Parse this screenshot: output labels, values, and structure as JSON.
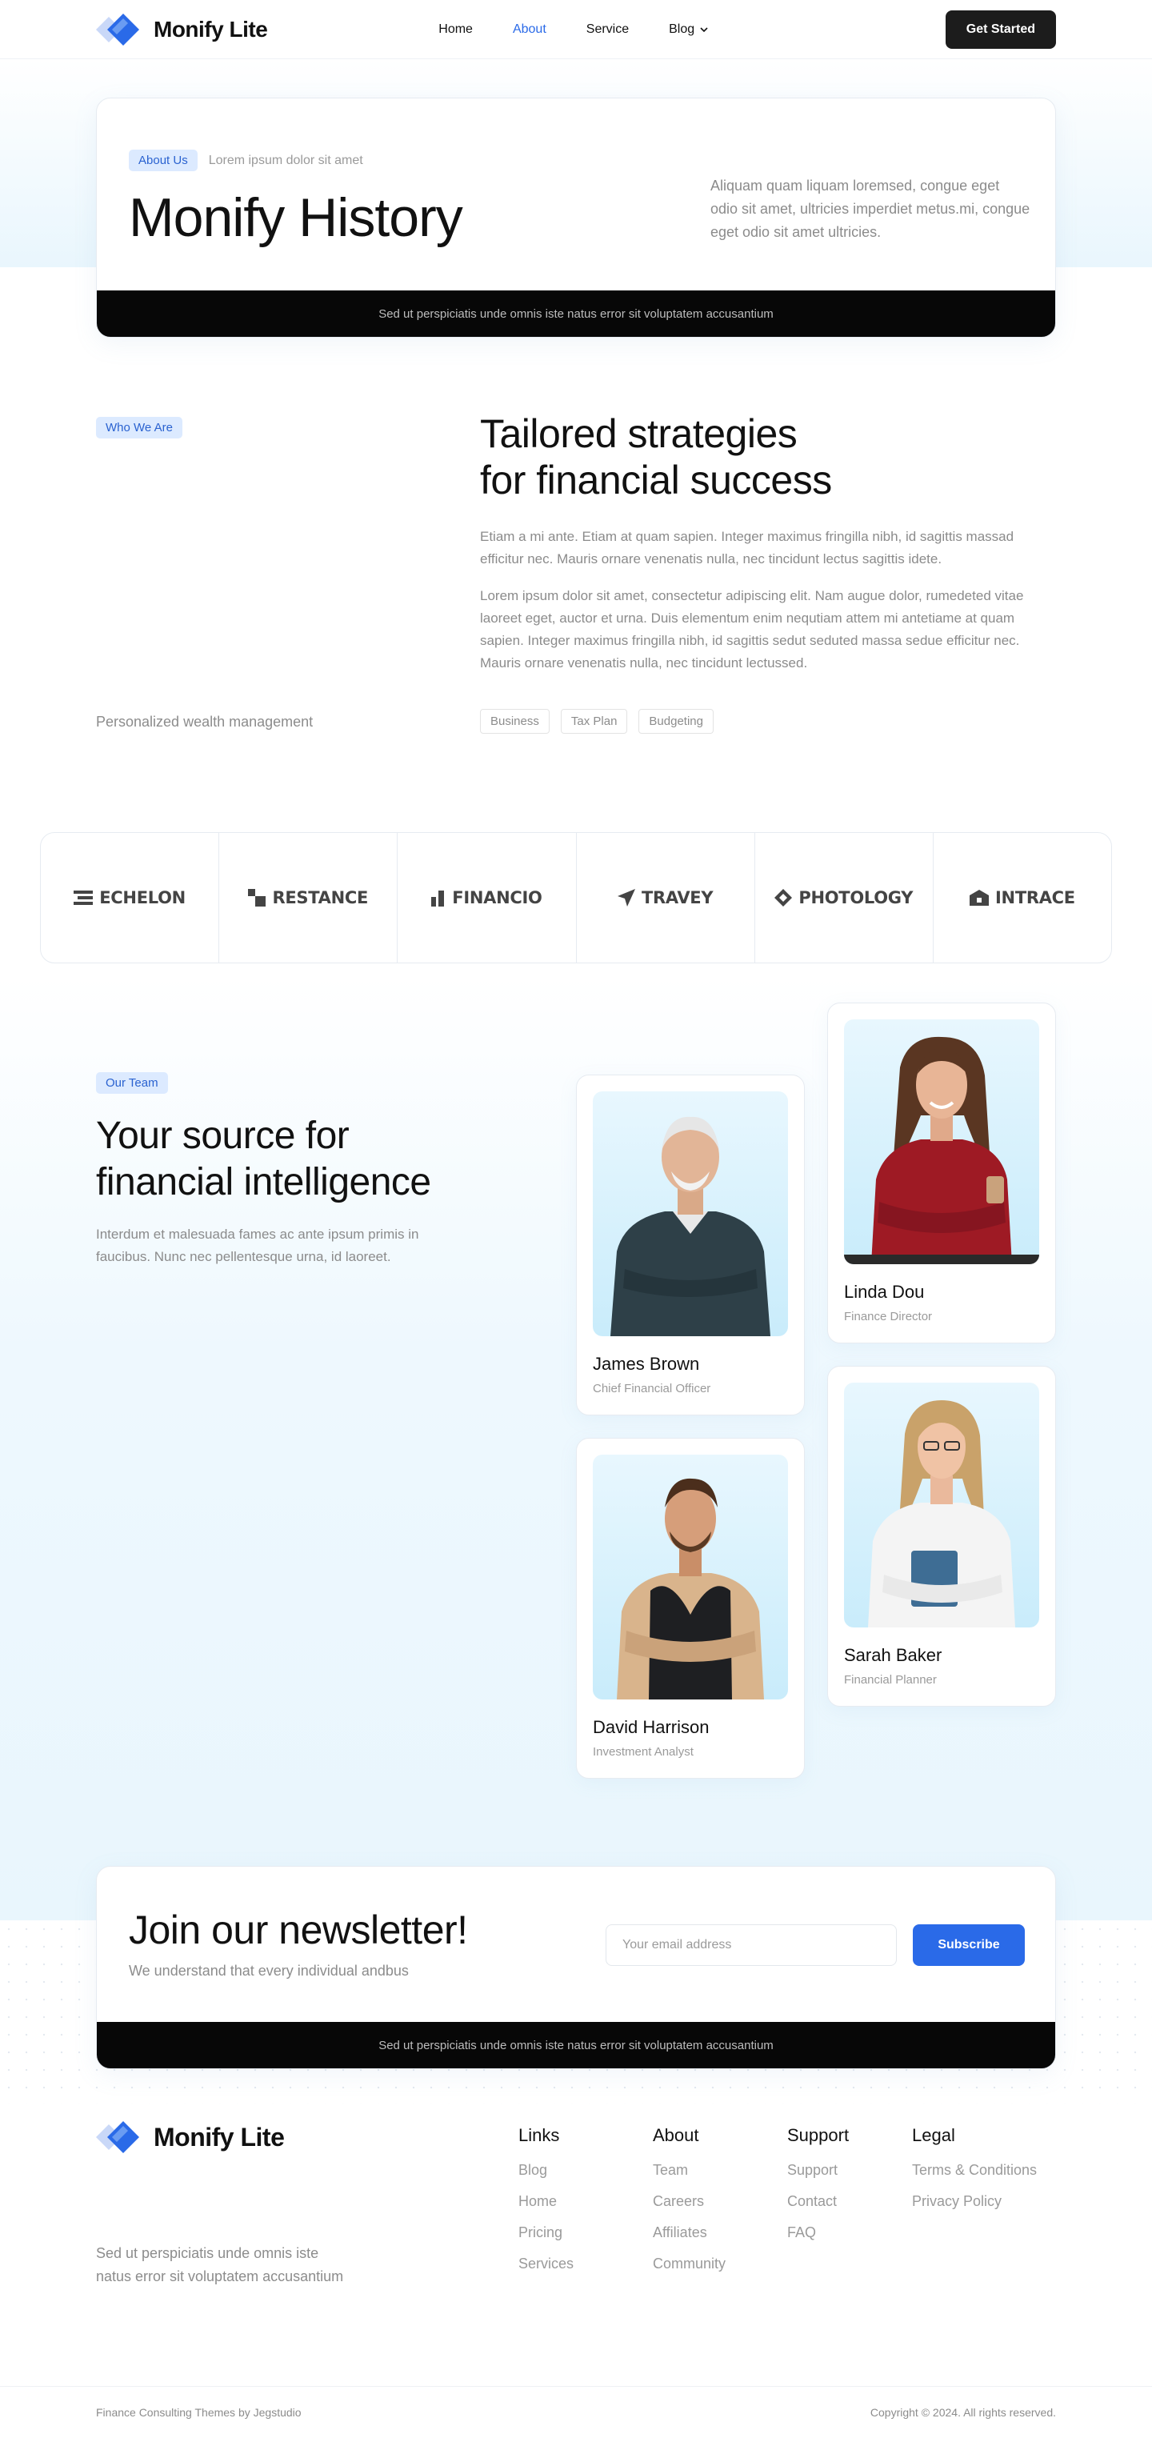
{
  "header": {
    "brand": "Monify Lite",
    "nav": [
      {
        "label": "Home",
        "active": false
      },
      {
        "label": "About",
        "active": true
      },
      {
        "label": "Service",
        "active": false
      },
      {
        "label": "Blog",
        "active": false
      }
    ],
    "cta_label": "Get Started"
  },
  "hero": {
    "badge": "About Us",
    "badge_sub": "Lorem ipsum dolor sit amet",
    "title": "Monify History",
    "description": "Aliquam quam liquam loremsed, congue eget odio sit amet, ultricies imperdiet metus.mi, congue eget odio sit amet ultricies.",
    "strip_text": "Sed ut perspiciatis unde omnis iste natus error sit voluptatem accusantium"
  },
  "who": {
    "badge": "Who We Are",
    "caption": "Personalized wealth management",
    "title_line1": "Tailored strategies",
    "title_line2": "for financial success",
    "p1": "Etiam a mi ante. Etiam at quam sapien. Integer maximus fringilla nibh, id sagittis massad efficitur nec. Mauris ornare venenatis nulla, nec tincidunt lectus sagittis idete.",
    "p2": "Lorem ipsum dolor sit amet, consectetur adipiscing elit. Nam augue dolor, rumedeted vitae laoreet eget, auctor et urna. Duis elementum enim nequtiam attem mi antetiame at quam sapien. Integer maximus fringilla nibh, id sagittis sedut seduted massa sedue efficitur nec. Mauris ornare venenatis nulla, nec tincidunt lectussed.",
    "tags": [
      "Business",
      "Tax Plan",
      "Budgeting"
    ]
  },
  "partners": [
    {
      "name": "ECHELON",
      "icon": "echelon-icon"
    },
    {
      "name": "RESTANCE",
      "icon": "restance-icon"
    },
    {
      "name": "FINANCIO",
      "icon": "financio-icon"
    },
    {
      "name": "TRAVEY",
      "icon": "travey-icon"
    },
    {
      "name": "PHOTOLOGY",
      "icon": "photology-icon"
    },
    {
      "name": "INTRACE",
      "icon": "intrace-icon"
    }
  ],
  "team": {
    "badge": "Our Team",
    "title_line1": "Your source for",
    "title_line2": "financial intelligence",
    "description": "Interdum et malesuada fames ac ante ipsum primis in faucibus. Nunc nec pellentesque urna, id laoreet.",
    "members": [
      {
        "name": "James Brown",
        "role": "Chief Financial Officer"
      },
      {
        "name": "Linda Dou",
        "role": "Finance Director"
      },
      {
        "name": "David Harrison",
        "role": "Investment Analyst"
      },
      {
        "name": "Sarah Baker",
        "role": "Financial Planner"
      }
    ]
  },
  "newsletter": {
    "title": "Join our newsletter!",
    "subtitle": "We understand that every individual andbus",
    "email_placeholder": "Your email address",
    "button_label": "Subscribe",
    "strip_text": "Sed ut perspiciatis unde omnis iste natus error sit voluptatem accusantium"
  },
  "footer": {
    "brand": "Monify Lite",
    "about_line1": "Sed ut perspiciatis unde omnis iste",
    "about_line2": "natus error sit voluptatem accusantium",
    "columns": [
      {
        "title": "Links",
        "items": [
          "Blog",
          "Home",
          "Pricing",
          "Services"
        ]
      },
      {
        "title": "About",
        "items": [
          "Team",
          "Careers",
          "Affiliates",
          "Community"
        ]
      },
      {
        "title": "Support",
        "items": [
          "Support",
          "Contact",
          "FAQ"
        ]
      },
      {
        "title": "Legal",
        "items": [
          "Terms & Conditions",
          "Privacy Policy"
        ]
      }
    ],
    "credit": "Finance Consulting Themes by Jegstudio",
    "copyright": "Copyright © 2024. All rights reserved."
  },
  "colors": {
    "accent": "#2a6ae8",
    "dark": "#1c1c1c",
    "strip": "#070707",
    "badge_bg": "#dceaff"
  }
}
